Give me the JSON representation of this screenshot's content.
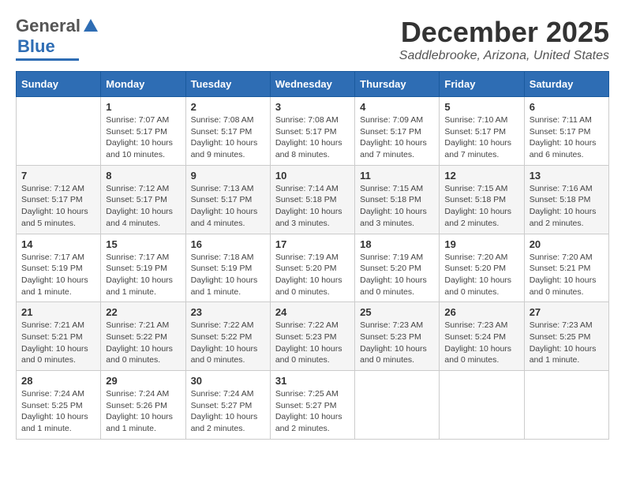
{
  "logo": {
    "line1": "General",
    "line2": "Blue"
  },
  "title": "December 2025",
  "subtitle": "Saddlebrooke, Arizona, United States",
  "days_of_week": [
    "Sunday",
    "Monday",
    "Tuesday",
    "Wednesday",
    "Thursday",
    "Friday",
    "Saturday"
  ],
  "weeks": [
    [
      {
        "day": "",
        "info": ""
      },
      {
        "day": "1",
        "info": "Sunrise: 7:07 AM\nSunset: 5:17 PM\nDaylight: 10 hours\nand 10 minutes."
      },
      {
        "day": "2",
        "info": "Sunrise: 7:08 AM\nSunset: 5:17 PM\nDaylight: 10 hours\nand 9 minutes."
      },
      {
        "day": "3",
        "info": "Sunrise: 7:08 AM\nSunset: 5:17 PM\nDaylight: 10 hours\nand 8 minutes."
      },
      {
        "day": "4",
        "info": "Sunrise: 7:09 AM\nSunset: 5:17 PM\nDaylight: 10 hours\nand 7 minutes."
      },
      {
        "day": "5",
        "info": "Sunrise: 7:10 AM\nSunset: 5:17 PM\nDaylight: 10 hours\nand 7 minutes."
      },
      {
        "day": "6",
        "info": "Sunrise: 7:11 AM\nSunset: 5:17 PM\nDaylight: 10 hours\nand 6 minutes."
      }
    ],
    [
      {
        "day": "7",
        "info": "Sunrise: 7:12 AM\nSunset: 5:17 PM\nDaylight: 10 hours\nand 5 minutes."
      },
      {
        "day": "8",
        "info": "Sunrise: 7:12 AM\nSunset: 5:17 PM\nDaylight: 10 hours\nand 4 minutes."
      },
      {
        "day": "9",
        "info": "Sunrise: 7:13 AM\nSunset: 5:17 PM\nDaylight: 10 hours\nand 4 minutes."
      },
      {
        "day": "10",
        "info": "Sunrise: 7:14 AM\nSunset: 5:18 PM\nDaylight: 10 hours\nand 3 minutes."
      },
      {
        "day": "11",
        "info": "Sunrise: 7:15 AM\nSunset: 5:18 PM\nDaylight: 10 hours\nand 3 minutes."
      },
      {
        "day": "12",
        "info": "Sunrise: 7:15 AM\nSunset: 5:18 PM\nDaylight: 10 hours\nand 2 minutes."
      },
      {
        "day": "13",
        "info": "Sunrise: 7:16 AM\nSunset: 5:18 PM\nDaylight: 10 hours\nand 2 minutes."
      }
    ],
    [
      {
        "day": "14",
        "info": "Sunrise: 7:17 AM\nSunset: 5:19 PM\nDaylight: 10 hours\nand 1 minute."
      },
      {
        "day": "15",
        "info": "Sunrise: 7:17 AM\nSunset: 5:19 PM\nDaylight: 10 hours\nand 1 minute."
      },
      {
        "day": "16",
        "info": "Sunrise: 7:18 AM\nSunset: 5:19 PM\nDaylight: 10 hours\nand 1 minute."
      },
      {
        "day": "17",
        "info": "Sunrise: 7:19 AM\nSunset: 5:20 PM\nDaylight: 10 hours\nand 0 minutes."
      },
      {
        "day": "18",
        "info": "Sunrise: 7:19 AM\nSunset: 5:20 PM\nDaylight: 10 hours\nand 0 minutes."
      },
      {
        "day": "19",
        "info": "Sunrise: 7:20 AM\nSunset: 5:20 PM\nDaylight: 10 hours\nand 0 minutes."
      },
      {
        "day": "20",
        "info": "Sunrise: 7:20 AM\nSunset: 5:21 PM\nDaylight: 10 hours\nand 0 minutes."
      }
    ],
    [
      {
        "day": "21",
        "info": "Sunrise: 7:21 AM\nSunset: 5:21 PM\nDaylight: 10 hours\nand 0 minutes."
      },
      {
        "day": "22",
        "info": "Sunrise: 7:21 AM\nSunset: 5:22 PM\nDaylight: 10 hours\nand 0 minutes."
      },
      {
        "day": "23",
        "info": "Sunrise: 7:22 AM\nSunset: 5:22 PM\nDaylight: 10 hours\nand 0 minutes."
      },
      {
        "day": "24",
        "info": "Sunrise: 7:22 AM\nSunset: 5:23 PM\nDaylight: 10 hours\nand 0 minutes."
      },
      {
        "day": "25",
        "info": "Sunrise: 7:23 AM\nSunset: 5:23 PM\nDaylight: 10 hours\nand 0 minutes."
      },
      {
        "day": "26",
        "info": "Sunrise: 7:23 AM\nSunset: 5:24 PM\nDaylight: 10 hours\nand 0 minutes."
      },
      {
        "day": "27",
        "info": "Sunrise: 7:23 AM\nSunset: 5:25 PM\nDaylight: 10 hours\nand 1 minute."
      }
    ],
    [
      {
        "day": "28",
        "info": "Sunrise: 7:24 AM\nSunset: 5:25 PM\nDaylight: 10 hours\nand 1 minute."
      },
      {
        "day": "29",
        "info": "Sunrise: 7:24 AM\nSunset: 5:26 PM\nDaylight: 10 hours\nand 1 minute."
      },
      {
        "day": "30",
        "info": "Sunrise: 7:24 AM\nSunset: 5:27 PM\nDaylight: 10 hours\nand 2 minutes."
      },
      {
        "day": "31",
        "info": "Sunrise: 7:25 AM\nSunset: 5:27 PM\nDaylight: 10 hours\nand 2 minutes."
      },
      {
        "day": "",
        "info": ""
      },
      {
        "day": "",
        "info": ""
      },
      {
        "day": "",
        "info": ""
      }
    ]
  ]
}
